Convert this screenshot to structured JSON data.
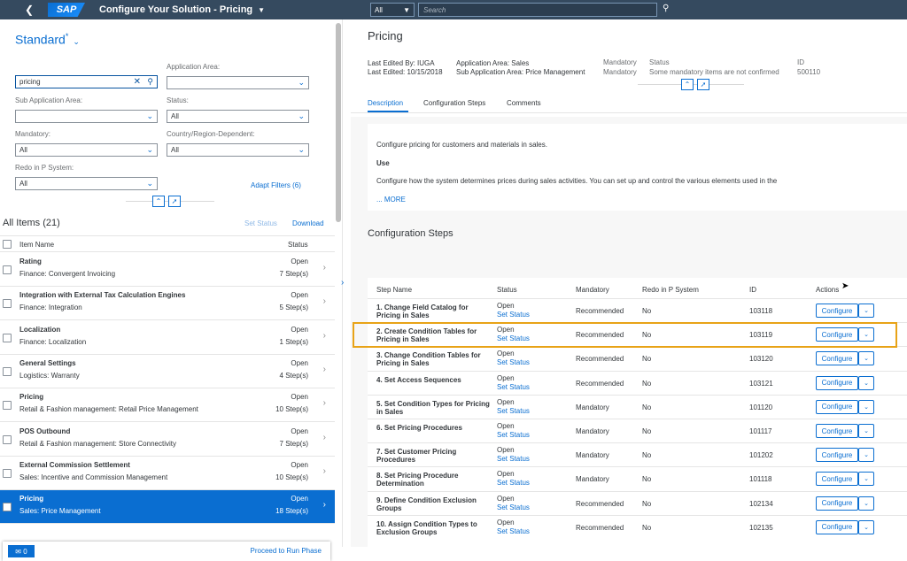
{
  "shell": {
    "title": "Configure Your Solution - Pricing",
    "scope": "All",
    "search_placeholder": "Search"
  },
  "filters": {
    "variant": "Standard",
    "variant_marker": "*",
    "search_value": "pricing",
    "application_area_label": "Application Area:",
    "application_area_value": "",
    "sub_application_area_label": "Sub Application Area:",
    "sub_application_area_value": "",
    "status_label": "Status:",
    "status_value": "All",
    "mandatory_label": "Mandatory:",
    "mandatory_value": "All",
    "country_label": "Country/Region-Dependent:",
    "country_value": "All",
    "redo_label": "Redo in P System:",
    "redo_value": "All",
    "adapt_filters": "Adapt Filters (6)"
  },
  "list": {
    "title": "All Items (21)",
    "set_status": "Set Status",
    "download": "Download",
    "col_item": "Item Name",
    "col_status": "Status",
    "items": [
      {
        "name": "Rating",
        "sub": "Finance: Convergent Invoicing",
        "status": "Open",
        "steps": "7 Step(s)"
      },
      {
        "name": "Integration with External Tax Calculation Engines",
        "sub": "Finance: Integration",
        "status": "Open",
        "steps": "5 Step(s)"
      },
      {
        "name": "Localization",
        "sub": "Finance: Localization",
        "status": "Open",
        "steps": "1 Step(s)"
      },
      {
        "name": "General Settings",
        "sub": "Logistics: Warranty",
        "status": "Open",
        "steps": "4 Step(s)"
      },
      {
        "name": "Pricing",
        "sub": "Retail & Fashion management: Retail Price Management",
        "status": "Open",
        "steps": "10 Step(s)"
      },
      {
        "name": "POS Outbound",
        "sub": "Retail & Fashion management: Store Connectivity",
        "status": "Open",
        "steps": "7 Step(s)"
      },
      {
        "name": "External Commission Settlement",
        "sub": "Sales: Incentive and Commission Management",
        "status": "Open",
        "steps": "10 Step(s)"
      },
      {
        "name": "Pricing",
        "sub": "Sales: Price Management",
        "status": "Open",
        "steps": "18 Step(s)"
      }
    ],
    "footer_count": "0",
    "proceed": "Proceed to Run Phase"
  },
  "detail": {
    "title": "Pricing",
    "last_edited_by": "Last Edited By: IUGA",
    "last_edited": "Last Edited: 10/15/2018",
    "app_area": "Application Area: Sales",
    "sub_app_area": "Sub Application Area: Price Management",
    "mandatory_1": "Mandatory",
    "mandatory_2": "Mandatory",
    "status_label": "Status",
    "status_value": "Some mandatory items are not confirmed",
    "id_label": "ID",
    "id_value": "500110",
    "tabs": [
      "Description",
      "Configuration Steps",
      "Comments"
    ],
    "desc_1": "Configure pricing for customers and materials in sales.",
    "desc_use": "Use",
    "desc_2": "Configure how the system determines prices during sales activities. You can set up and control the various elements used in the",
    "desc_more": "... MORE"
  },
  "steps": {
    "heading": "Configuration Steps",
    "headers": [
      "Step Name",
      "Status",
      "Mandatory",
      "Redo in P System",
      "ID",
      "Actions"
    ],
    "configure_label": "Configure",
    "rows": [
      {
        "name": "1. Change Field Catalog for Pricing in Sales",
        "status": "Open",
        "set": "Set Status",
        "mandatory": "Recommended",
        "redo": "No",
        "id": "103118"
      },
      {
        "name": "2. Create Condition Tables for Pricing in Sales",
        "status": "Open",
        "set": "Set Status",
        "mandatory": "Recommended",
        "redo": "No",
        "id": "103119"
      },
      {
        "name": "3. Change Condition Tables for Pricing in Sales",
        "status": "Open",
        "set": "Set Status",
        "mandatory": "Recommended",
        "redo": "No",
        "id": "103120"
      },
      {
        "name": "4. Set Access Sequences",
        "status": "Open",
        "set": "Set Status",
        "mandatory": "Recommended",
        "redo": "No",
        "id": "103121"
      },
      {
        "name": "5. Set Condition Types for Pricing in Sales",
        "status": "Open",
        "set": "Set Status",
        "mandatory": "Mandatory",
        "redo": "No",
        "id": "101120"
      },
      {
        "name": "6. Set Pricing Procedures",
        "status": "Open",
        "set": "Set Status",
        "mandatory": "Mandatory",
        "redo": "No",
        "id": "101117"
      },
      {
        "name": "7. Set Customer Pricing Procedures",
        "status": "Open",
        "set": "Set Status",
        "mandatory": "Mandatory",
        "redo": "No",
        "id": "101202"
      },
      {
        "name": "8. Set Pricing Procedure Determination",
        "status": "Open",
        "set": "Set Status",
        "mandatory": "Mandatory",
        "redo": "No",
        "id": "101118"
      },
      {
        "name": "9. Define Condition Exclusion Groups",
        "status": "Open",
        "set": "Set Status",
        "mandatory": "Recommended",
        "redo": "No",
        "id": "102134"
      },
      {
        "name": "10. Assign Condition Types to Exclusion Groups",
        "status": "Open",
        "set": "Set Status",
        "mandatory": "Recommended",
        "redo": "No",
        "id": "102135"
      }
    ]
  }
}
